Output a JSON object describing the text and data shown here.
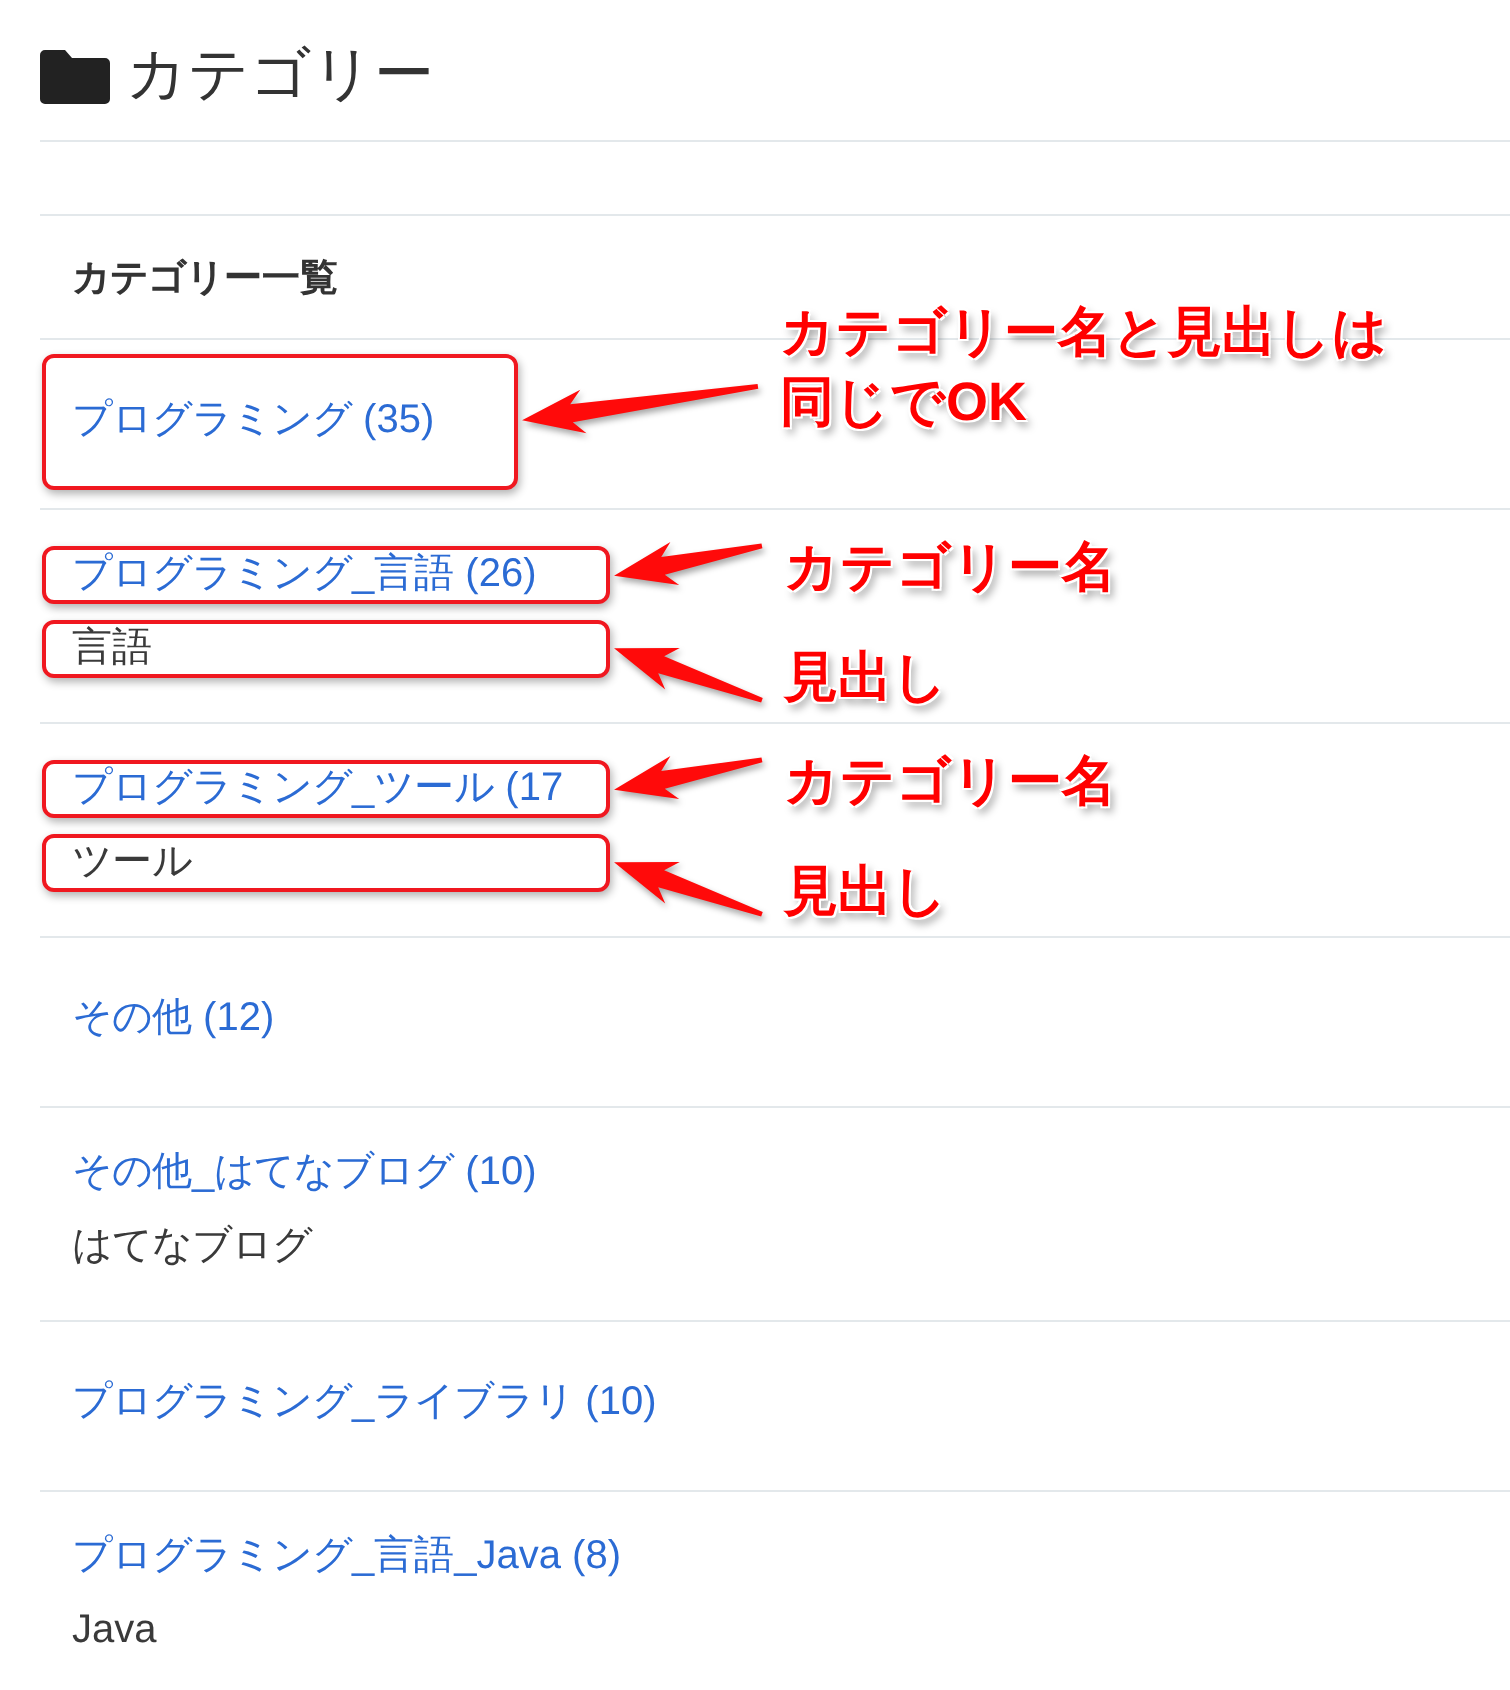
{
  "page_title": "カテゴリー",
  "category_list": {
    "heading": "カテゴリー一覧",
    "items": [
      {
        "name": "プログラミング (35)",
        "name_callout": "カテゴリー名と見出しは同じでOK"
      },
      {
        "name": "プログラミング_言語 (26)",
        "description": "言語",
        "name_callout": "カテゴリー名",
        "description_callout": "見出し"
      },
      {
        "name": "プログラミング_ツール (17",
        "description": "ツール",
        "name_callout": "カテゴリー名",
        "description_callout": "見出し"
      },
      {
        "name": "その他 (12)"
      },
      {
        "name": "その他_はてなブログ (10)",
        "description": "はてなブログ"
      },
      {
        "name": "プログラミング_ライブラリ (10)"
      },
      {
        "name": "プログラミング_言語_Java (8)",
        "description": "Java"
      }
    ]
  }
}
